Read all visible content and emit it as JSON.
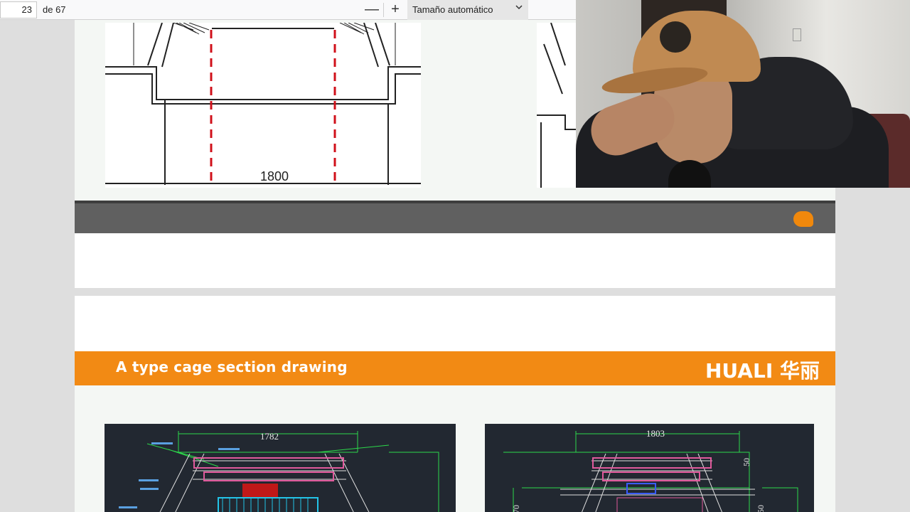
{
  "toolbar": {
    "page_number": "23",
    "page_total": "de 67",
    "zoom_out_label": "—",
    "zoom_in_label": "+",
    "zoom_value": "Tamaño automático"
  },
  "page1": {
    "dimension_label": "1800"
  },
  "page2": {
    "banner_title": "A type cage section drawing",
    "brand": "HUALI 华丽",
    "cad_left_dimension": "1782",
    "cad_right_dimension": "1803",
    "cad_right_side_dim_a": "50",
    "cad_right_side_dim_b": "70",
    "cad_right_side_dim_c": "50"
  },
  "colors": {
    "accent_orange": "#f28a14",
    "footer_gray": "#606060",
    "cad_background": "#222831",
    "dashed_red": "#d0101a"
  }
}
